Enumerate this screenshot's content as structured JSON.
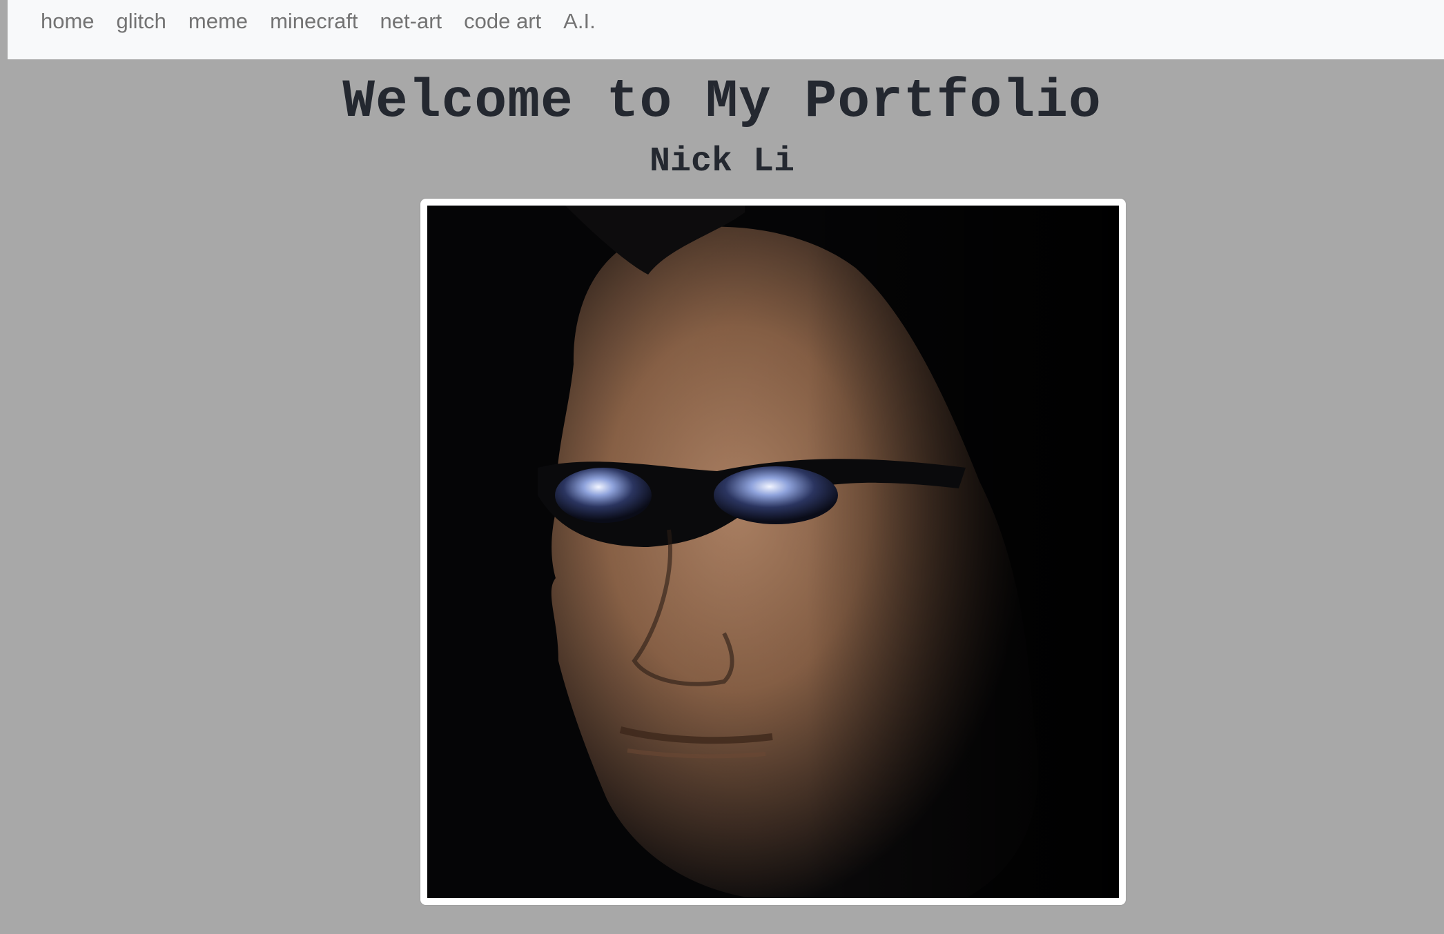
{
  "nav": {
    "items": [
      {
        "label": "home"
      },
      {
        "label": "glitch"
      },
      {
        "label": "meme"
      },
      {
        "label": "minecraft"
      },
      {
        "label": "net-art"
      },
      {
        "label": "code art"
      },
      {
        "label": "A.I."
      }
    ]
  },
  "header": {
    "title": "Welcome to My Portfolio",
    "subtitle": "Nick Li"
  },
  "colors": {
    "page_background": "#a8a8a8",
    "navbar_background": "#f8f9fa",
    "nav_link": "#737373",
    "heading_text": "#242830"
  }
}
